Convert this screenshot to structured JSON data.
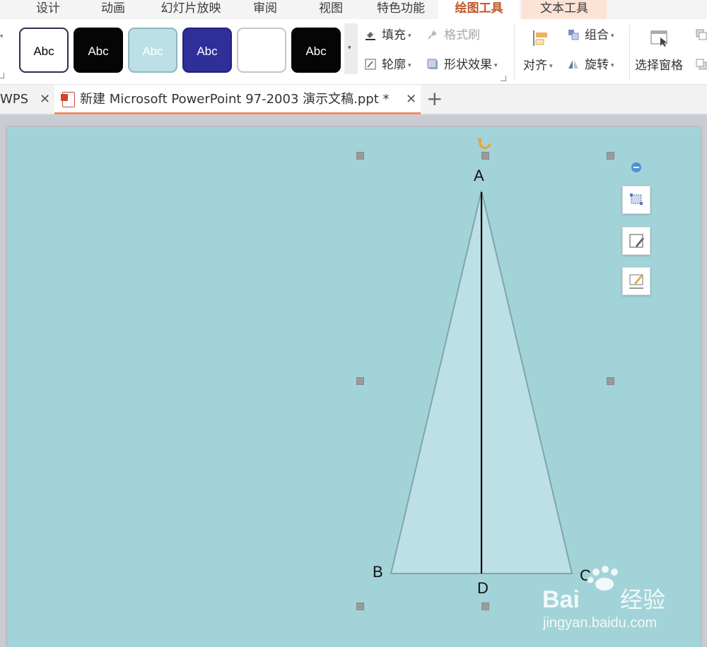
{
  "menu": {
    "tabs": [
      {
        "label": "设计"
      },
      {
        "label": "动画"
      },
      {
        "label": "幻灯片放映"
      },
      {
        "label": "审阅"
      },
      {
        "label": "视图"
      },
      {
        "label": "特色功能"
      },
      {
        "label": "绘图工具"
      },
      {
        "label": "文本工具"
      }
    ],
    "active": "绘图工具"
  },
  "ribbon": {
    "style_gallery": [
      {
        "label": "Abc",
        "fill": "#ffffff",
        "border": "#2d2d5a",
        "text": "#000000"
      },
      {
        "label": "Abc",
        "fill": "#050505",
        "border": "#050505",
        "text": "#ffffff"
      },
      {
        "label": "Abc",
        "fill": "#bde0e6",
        "border": "#8fb7bc",
        "text": "#ffffff"
      },
      {
        "label": "Abc",
        "fill": "#2f2f9a",
        "border": "#23237a",
        "text": "#ffffff"
      },
      {
        "label": "",
        "fill": "#ffffff",
        "border": "#c6c6c6",
        "text": "#000000"
      },
      {
        "label": "Abc",
        "fill": "#050505",
        "border": "#050505",
        "text": "#ffffff"
      }
    ],
    "fill_label": "填充",
    "format_painter_label": "格式刷",
    "outline_label": "轮廓",
    "shape_effects_label": "形状效果",
    "align_label": "对齐",
    "group_label": "组合",
    "rotate_label": "旋转",
    "selection_pane_label": "选择窗格"
  },
  "doc_tabs": {
    "home_label": "WPS",
    "active_label": "新建 Microsoft PowerPoint 97-2003 演示文稿.ppt *"
  },
  "slide": {
    "background": "#a2d3d8",
    "triangle_fill": "#bde0e6",
    "triangle_stroke": "#7fa5aa",
    "labels": {
      "a": "A",
      "b": "B",
      "c": "C",
      "d": "D"
    }
  },
  "watermark": {
    "brand": "Bai",
    "brand_suffix": "经验",
    "url": "jingyan.baidu.com"
  },
  "colors": {
    "accent": "#c0582a",
    "active_tab_underline": "#ef8c62",
    "handle": "#9a9a9a",
    "rotate_handle": "#f0a020"
  }
}
